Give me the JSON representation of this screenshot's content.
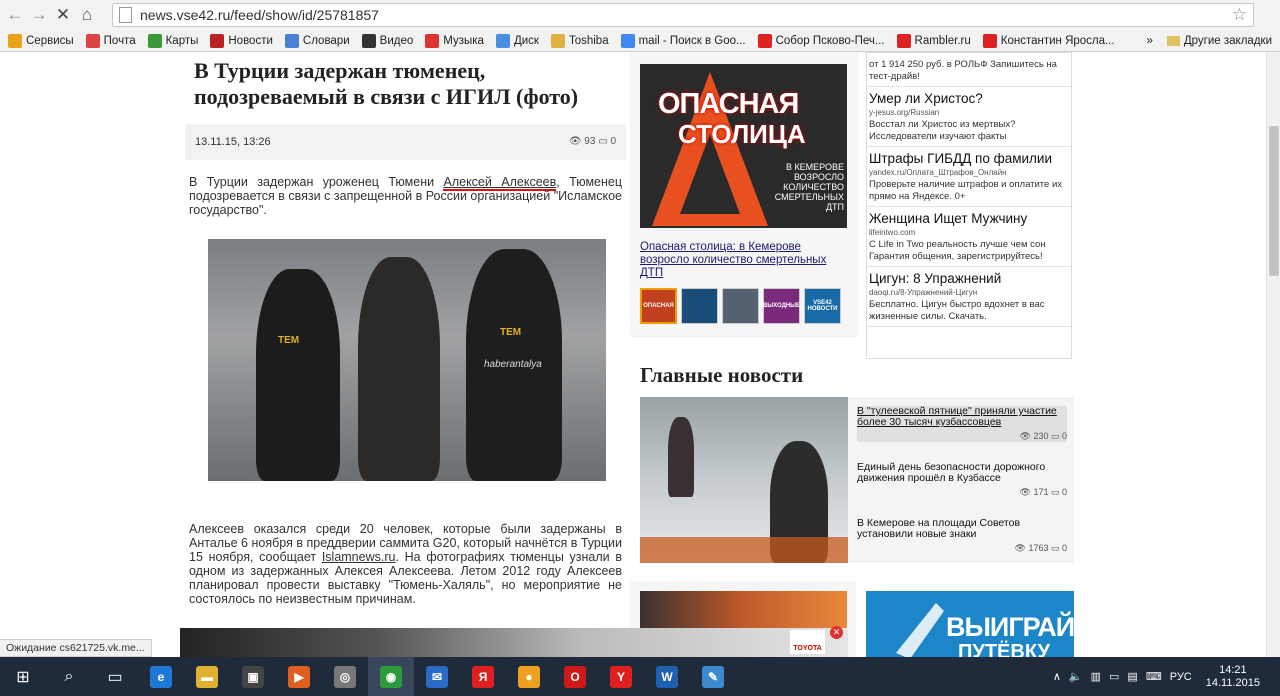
{
  "browser": {
    "url": "news.vse42.ru/feed/show/id/25781857",
    "bookmarks": [
      {
        "label": "Сервисы",
        "color": "#e8a21a"
      },
      {
        "label": "Почта",
        "color": "#d44"
      },
      {
        "label": "Карты",
        "color": "#3a9a3a"
      },
      {
        "label": "Новости",
        "color": "#b22"
      },
      {
        "label": "Словари",
        "color": "#4a7fd4"
      },
      {
        "label": "Видео",
        "color": "#333"
      },
      {
        "label": "Музыка",
        "color": "#d33"
      },
      {
        "label": "Диск",
        "color": "#4a90e2"
      },
      {
        "label": "Toshiba",
        "color": "#e0b040"
      },
      {
        "label": "mail - Поиск в Goo...",
        "color": "#4285f4"
      },
      {
        "label": "Собор Псково-Печ...",
        "color": "#d22"
      },
      {
        "label": "Rambler.ru",
        "color": "#d22"
      },
      {
        "label": "Константин Яросла...",
        "color": "#d22"
      }
    ],
    "more_bookmarks": "»",
    "other_bookmarks": "Другие закладки",
    "status": "Ожидание cs621725.vk.me..."
  },
  "article": {
    "title": "В Турции задержан тюменец, подозреваемый в связи с ИГИЛ (фото)",
    "date": "13.11.15, 13:26",
    "views": "93",
    "comments": "0",
    "p1_a": "В Турции задержан уроженец Тюмени ",
    "p1_link": "Алексей Алексеев",
    "p1_b": ", Тюменец подозревается в связи с запрещенной в России организацией \"Исламское государство\".",
    "photo_label_1": "TEM",
    "photo_label_2": "TEM",
    "photo_watermark": "haberantalya",
    "p2_a": "Алексеев оказался среди 20 человек, которые были задержаны в Анталье 6 ноября в преддверии саммита G20, который начнётся в Турции 15 ноября, сообщает ",
    "p2_link": "Islamnews.ru",
    "p2_b": ". На фотографиях тюменцы узнали в одном из задержанных Алексея Алексеева. Летом 2012 году Алексеев планировал провести выставку \"Тюмень-Халяль\", но мероприятие не состоялось по неизвестным причинам."
  },
  "promo": {
    "line1": "ОПАСНАЯ",
    "line2": "СТОЛИЦА",
    "line3": "В КЕМЕРОВЕ ВОЗРОСЛО КОЛИЧЕСТВО СМЕРТЕЛЬНЫХ ДТП",
    "caption": "Опасная столица: в Кемерове возросло количество смертельных ДТП",
    "thumbs": [
      {
        "label": "ОПАСНАЯ",
        "color": "#c04020"
      },
      {
        "label": "",
        "color": "#1a4c7a"
      },
      {
        "label": "",
        "color": "#556070"
      },
      {
        "label": "ВЫХОДНЫЕ",
        "color": "#7a2a7a"
      },
      {
        "label": "VSE42 НОВОСТИ",
        "color": "#1a6aa8"
      }
    ]
  },
  "ads": [
    {
      "title": "",
      "url": "",
      "desc": "от 1 914 250 руб. в РОЛЬФ Запишитесь на тест-драйв!"
    },
    {
      "title": "Умер ли Христос?",
      "url": "y-jesus.org/Russian",
      "desc": "Восстал ли Христос из мертвых? Исследователи изучают факты"
    },
    {
      "title": "Штрафы ГИБДД по фамилии",
      "url": "yandex.ru/Оплата_Штрафов_Онлайн",
      "desc": "Проверьте наличие штрафов и оплатите их прямо на Яндексе. 0+"
    },
    {
      "title": "Женщина Ищет Мужчину",
      "url": "lifeintwo.com",
      "desc": "С Life in Two реальность лучше чем сон Гарантия общения, зарегистрируйтесь!"
    },
    {
      "title": "Цигун: 8 Упражнений",
      "url": "daoqi.ru/8-Упражнений-Цигун",
      "desc": "Бесплатно. Цигун быстро вдохнет в вас жизненные силы. Скачать."
    }
  ],
  "news": {
    "heading": "Главные новости",
    "items": [
      {
        "title": "В \"тулеевской пятнице\" приняли участие более 30 тысяч кузбассовцев",
        "views": "230",
        "comments": "0"
      },
      {
        "title": "Единый день безопасности дорожного движения прошёл в Кузбассе",
        "views": "171",
        "comments": "0"
      },
      {
        "title": "В Кемерове на площади Советов установили новые знаки",
        "views": "1763",
        "comments": "0"
      }
    ]
  },
  "banner": {
    "line1": "ВЫИГРАЙ",
    "line2": "ПУТЁВКУ"
  },
  "adstrip_logo": "TOYOTA",
  "taskbar": {
    "lang": "РУС",
    "time": "14:21",
    "date": "14.11.2015",
    "apps": [
      {
        "name": "edge",
        "label": "e",
        "color": "#1e78d6"
      },
      {
        "name": "explorer",
        "label": "▬",
        "color": "#e0b030"
      },
      {
        "name": "store",
        "label": "▣",
        "color": "#444"
      },
      {
        "name": "media",
        "label": "▶",
        "color": "#e06020"
      },
      {
        "name": "app-circle",
        "label": "◎",
        "color": "#777"
      },
      {
        "name": "chrome",
        "label": "◉",
        "color": "#2a9a3a"
      },
      {
        "name": "mail",
        "label": "✉",
        "color": "#2a6ac8"
      },
      {
        "name": "yandex",
        "label": "Я",
        "color": "#e02020"
      },
      {
        "name": "app-orange",
        "label": "●",
        "color": "#f0a020"
      },
      {
        "name": "opera",
        "label": "O",
        "color": "#d01818"
      },
      {
        "name": "yandex-browser",
        "label": "Y",
        "color": "#e02020"
      },
      {
        "name": "word",
        "label": "W",
        "color": "#1f5fb0"
      },
      {
        "name": "app-paint",
        "label": "✎",
        "color": "#3a8ad0"
      }
    ]
  }
}
